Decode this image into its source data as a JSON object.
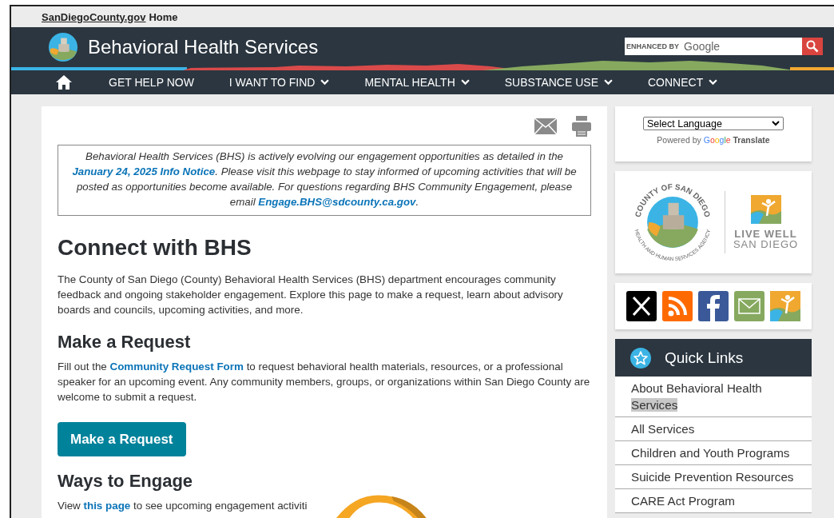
{
  "top_bar": {
    "site_link": "SanDiegoCounty.gov",
    "home_label": "Home"
  },
  "header": {
    "title": "Behavioral Health Services",
    "search": {
      "placeholder_small": "ENHANCED BY",
      "placeholder_brand": "Google"
    }
  },
  "nav": [
    {
      "label": "GET HELP NOW",
      "has_menu": false
    },
    {
      "label": "I WANT TO FIND",
      "has_menu": true
    },
    {
      "label": "MENTAL HEALTH",
      "has_menu": true
    },
    {
      "label": "SUBSTANCE USE",
      "has_menu": true
    },
    {
      "label": "CONNECT",
      "has_menu": true
    }
  ],
  "notice": [
    {
      "kind": "text",
      "text": "Behavioral Health Services (BHS) is actively evolving our engagement opportunities as detailed in the "
    },
    {
      "kind": "link",
      "text": "January 24, 2025 Info Notice"
    },
    {
      "kind": "text",
      "text": ". Please visit this webpage to stay informed of upcoming activities that will be posted as opportunities become available. For questions regarding BHS Community Engagement, please email "
    },
    {
      "kind": "link",
      "text": "Engage.BHS@sdcounty.ca.gov"
    },
    {
      "kind": "text",
      "text": "."
    }
  ],
  "content": [
    {
      "kind": "h1",
      "parts": [
        {
          "kind": "text",
          "text": "Connect with BHS"
        }
      ]
    },
    {
      "kind": "p",
      "parts": [
        {
          "kind": "text",
          "text": "The County of San Diego (County) Behavioral Health Services (BHS) department encourages community feedback and ongoing stakeholder engagement. Explore this page to make a request, learn about advisory boards and councils, upcoming activities, and more."
        }
      ]
    },
    {
      "kind": "h2",
      "parts": [
        {
          "kind": "text",
          "text": "Make a Request"
        }
      ]
    },
    {
      "kind": "p",
      "parts": [
        {
          "kind": "text",
          "text": "Fill out the "
        },
        {
          "kind": "link",
          "text": "Community Request Form"
        },
        {
          "kind": "text",
          "text": " to request behavioral health materials, resources, or a professional speaker for an upcoming event. Any community members, groups, or organizations within San Diego County are welcome to submit a request."
        }
      ]
    },
    {
      "kind": "button",
      "parts": [
        {
          "kind": "text",
          "text": "Make a Request"
        }
      ]
    },
    {
      "kind": "h2",
      "parts": [
        {
          "kind": "text",
          "text": "Ways to Engage"
        }
      ]
    },
    {
      "kind": "p",
      "parts": [
        {
          "kind": "text",
          "text": "View "
        },
        {
          "kind": "link",
          "text": "this page"
        },
        {
          "kind": "text",
          "text": " to see upcoming engagement activiti"
        }
      ]
    }
  ],
  "sidebar": {
    "language_select": "Select Language",
    "powered_by": {
      "prefix": "Powered by",
      "brand": "Google",
      "suffix": "Translate"
    },
    "seal": {
      "top_text": "COUNTY OF SAN DIEGO",
      "bottom_text": "HEALTH AND HUMAN SERVICES AGENCY"
    },
    "live_well": {
      "line_1": "LIVE WELL",
      "line_2": "SAN DIEGO"
    },
    "quick_links": {
      "title": "Quick Links",
      "items": [
        {
          "label": "About Behavioral Health ",
          "selected_text": "Services"
        },
        {
          "label": "All Services"
        },
        {
          "label": "Children and Youth Programs"
        },
        {
          "label": "Suicide Prevention Resources"
        },
        {
          "label": "CARE Act Program"
        }
      ]
    }
  }
}
